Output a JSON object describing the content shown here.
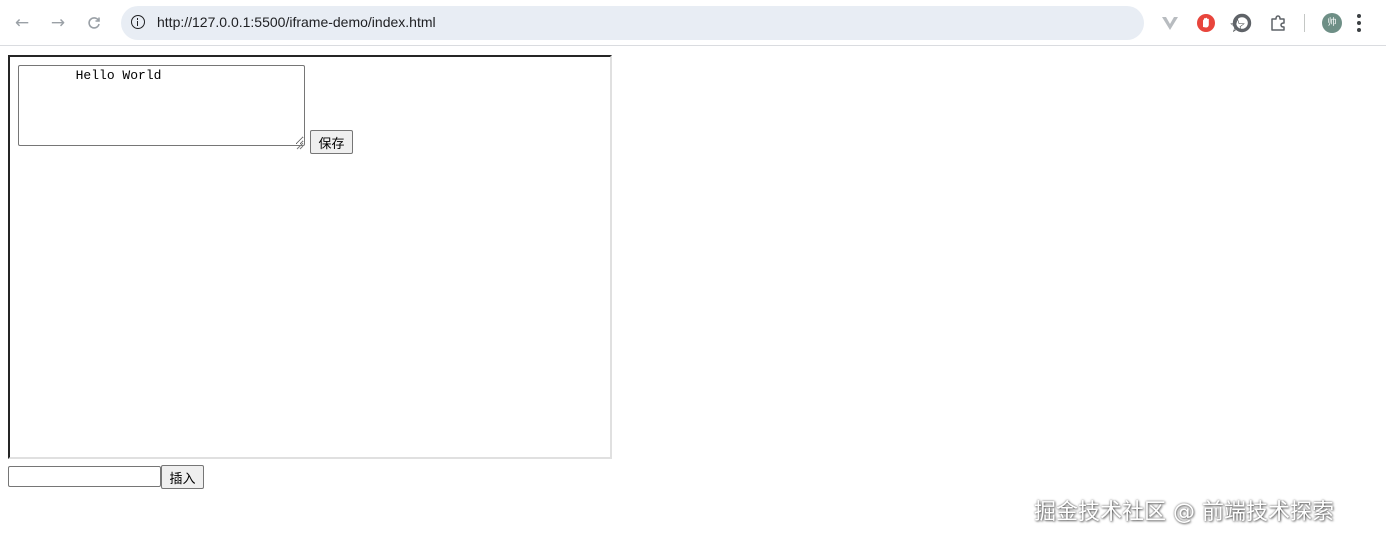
{
  "browser": {
    "url": "http://127.0.0.1:5500/iframe-demo/index.html",
    "icons": {
      "back": "back-arrow-icon",
      "forward": "forward-arrow-icon",
      "reload": "reload-icon",
      "site_info": "info-icon",
      "bookmark": "star-icon",
      "vue_devtools": "vue-devtools-icon",
      "adblock": "adblock-icon",
      "extension_circle": "circle-extension-icon",
      "extensions": "puzzle-icon",
      "menu": "kebab-menu-icon"
    },
    "avatar_text": "帅"
  },
  "iframe": {
    "textarea_value": "       Hello World",
    "save_label": "保存"
  },
  "outer": {
    "input_value": "",
    "insert_label": "插入"
  },
  "watermark": "掘金技术社区 @ 前端技术探索",
  "colors": {
    "chrome_bg": "#ffffff",
    "omnibox_bg": "#e8edf4",
    "button_bg": "#efefef",
    "adblock_red": "#e8453c",
    "avatar_green": "#6e8f86"
  }
}
